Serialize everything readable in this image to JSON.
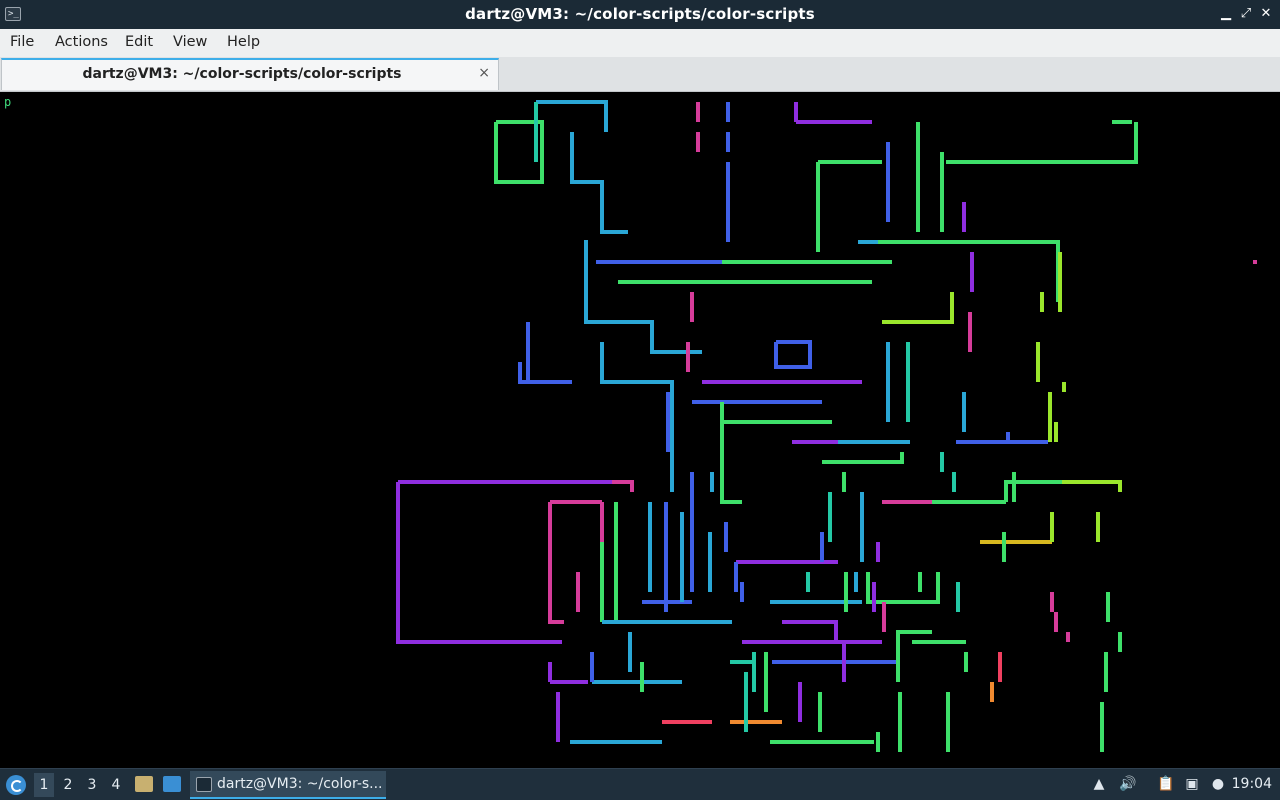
{
  "window": {
    "title": "dartz@VM3: ~/color-scripts/color-scripts",
    "minimize_glyph": "▁",
    "restore_glyph": "⤢",
    "close_glyph": "✕"
  },
  "menu": {
    "items": [
      "File",
      "Actions",
      "Edit",
      "View",
      "Help"
    ]
  },
  "tabs": [
    {
      "label": "dartz@VM3: ~/color-scripts/color-scripts",
      "close_glyph": "×"
    }
  ],
  "terminal": {
    "prompt": "p",
    "colors": {
      "magenta": "#d63c9a",
      "purple": "#8f2ee0",
      "blue": "#4060e8",
      "cyan": "#2aa7d6",
      "teal": "#24c9a6",
      "green": "#3ee06a",
      "lime": "#9be62c",
      "red": "#f04060",
      "orange": "#f08a30",
      "yellow": "#d8b820"
    }
  },
  "taskbar": {
    "workspaces": [
      "1",
      "2",
      "3",
      "4"
    ],
    "active_workspace": "1",
    "task_label": "dartz@VM3: ~/color-s...",
    "clock": "19:04",
    "tray_icons": [
      "scroll-up-icon",
      "volume-icon",
      "clipboard-icon",
      "network-icon",
      "update-icon"
    ]
  }
}
